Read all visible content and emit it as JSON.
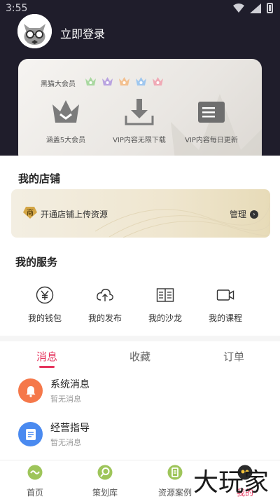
{
  "status_bar": {
    "time": "3:55"
  },
  "header": {
    "login_label": "立即登录"
  },
  "vip": {
    "label": "黑猫大会员",
    "features": [
      {
        "label": "涵盖5大会员",
        "icon": "crown-icon"
      },
      {
        "label": "VIP内容无限下载",
        "icon": "download-icon"
      },
      {
        "label": "VIP内容每日更新",
        "icon": "document-stack-icon"
      }
    ]
  },
  "shop": {
    "title": "我的店铺",
    "badge": "商",
    "banner_text": "开通店铺上传资源",
    "manage_label": "管理"
  },
  "services": {
    "title": "我的服务",
    "items": [
      {
        "label": "我的钱包",
        "icon": "yen-icon"
      },
      {
        "label": "我的发布",
        "icon": "cloud-upload-icon"
      },
      {
        "label": "我的沙龙",
        "icon": "book-icon"
      },
      {
        "label": "我的课程",
        "icon": "video-icon"
      }
    ]
  },
  "tabs": [
    {
      "label": "消息",
      "active": true
    },
    {
      "label": "收藏",
      "active": false
    },
    {
      "label": "订单",
      "active": false
    }
  ],
  "messages": [
    {
      "title": "系统消息",
      "subtitle": "暂无消息",
      "icon": "bell-icon",
      "color": "#f5784a"
    },
    {
      "title": "经营指导",
      "subtitle": "暂无消息",
      "icon": "document-icon",
      "color": "#4a8af0"
    }
  ],
  "bottom_nav": [
    {
      "label": "首页",
      "icon": "home-icon",
      "active": false
    },
    {
      "label": "策划库",
      "icon": "search-icon",
      "active": false
    },
    {
      "label": "资源案例",
      "icon": "case-icon",
      "active": false
    },
    {
      "label": "我的",
      "icon": "cat-icon",
      "active": true
    }
  ],
  "watermark": {
    "text": "大玩家"
  },
  "colors": {
    "accent": "#e5335c",
    "header_bg": "#1f1d2b",
    "nav_icon_green": "#9ec55a"
  }
}
